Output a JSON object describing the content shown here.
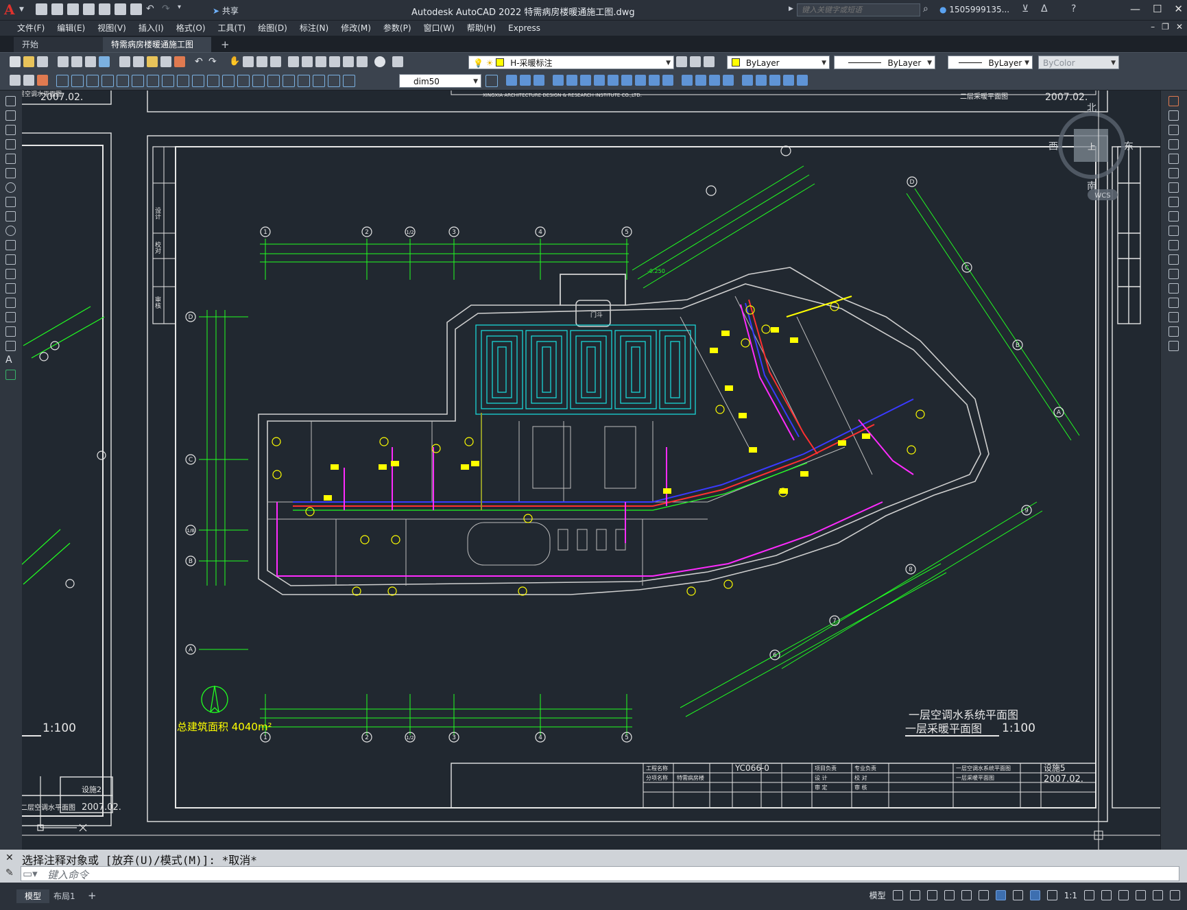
{
  "app": {
    "logo": "A",
    "title": "Autodesk AutoCAD 2022    特需病房楼暖通施工图.dwg",
    "share": "共享",
    "search_placeholder": "键入关键字或短语",
    "user": "1505999135...",
    "window_buttons": [
      "—",
      "☐",
      "✕"
    ]
  },
  "menu": [
    "文件(F)",
    "编辑(E)",
    "视图(V)",
    "插入(I)",
    "格式(O)",
    "工具(T)",
    "绘图(D)",
    "标注(N)",
    "修改(M)",
    "参数(P)",
    "窗口(W)",
    "帮助(H)",
    "Express"
  ],
  "tabs": {
    "start": "开始",
    "active": "特需病房楼暖通施工图*",
    "add": "+"
  },
  "toolbar": {
    "layer": "H-采暖标注",
    "color": "ByLayer",
    "linetype": "ByLayer",
    "lineweight": "ByLayer",
    "plotstyle": "ByColor",
    "dimstyle": "dim50"
  },
  "drawing": {
    "title_line1": "一层空调水系统平面图",
    "title_line2": "一层采暖平面图",
    "scale": "1:100",
    "scale_left": "1:100",
    "area_label": "总建筑面积 4040m²",
    "drawing_no": "YC066-0",
    "sheet_no": "设施5",
    "sheet_no_left": "设施2",
    "date": "2007.02.",
    "institute": "XINGXIA ARCHITECTURE DESIGN & RESEARCH INSTITUTE CO.,LTD.",
    "title_block_name": "二层采暖平面图",
    "title_block_left": "二层空调水平面图",
    "titleblock_plan1": "一层空调水系统平面图",
    "titleblock_plan2": "一层采暖平面图",
    "titleblock_project": "特需病房楼",
    "titleblock_labels": [
      "工程名称",
      "分项名称",
      "项目负责",
      "专业负责",
      "设 计",
      "校 对",
      "审 定",
      "审 核"
    ],
    "room_callout": "门斗",
    "elevation": "-0.250",
    "sheet_labels_left": [
      "设计",
      "校对",
      "审核"
    ],
    "axes_top": [
      "1",
      "2",
      "1/2",
      "3",
      "4",
      "5"
    ],
    "axes_bottom": [
      "1",
      "2",
      "1/2",
      "3",
      "4",
      "5"
    ],
    "axes_left": [
      "D",
      "C",
      "1/B",
      "B",
      "A"
    ],
    "axes_diag": [
      "6",
      "7",
      "8",
      "9",
      "D",
      "C",
      "B",
      "A"
    ]
  },
  "viewcube": {
    "north": "北",
    "south": "南",
    "east": "东",
    "west": "西",
    "top": "上",
    "wcs": "WCS"
  },
  "command": {
    "history": "选择注释对象或 [放弃(U)/模式(M)]: *取消*",
    "placeholder": "键入命令"
  },
  "status": {
    "model_tab": "模型",
    "layout_tab": "布局1",
    "add": "+",
    "model_label": "模型",
    "scale": "1:1"
  },
  "colors": {
    "accent_red": "#e0322d",
    "floor_heating": "#19d6d6",
    "pipe_magenta": "#ff2bff",
    "pipe_blue": "#3a3aff",
    "pipe_red": "#ff3030",
    "dim_green": "#21ff21",
    "label_yellow": "#ffff00"
  }
}
